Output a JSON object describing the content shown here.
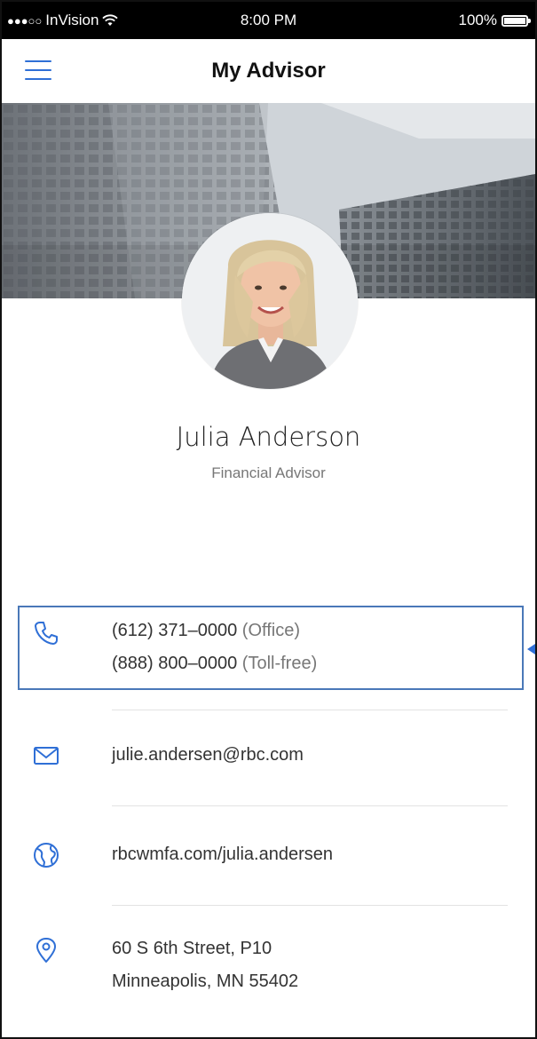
{
  "status_bar": {
    "signal_dots": "●●●○○",
    "carrier": "InVision",
    "time": "8:00 PM",
    "battery": "100%"
  },
  "nav": {
    "title": "My Advisor",
    "menu_icon": "hamburger-menu-icon"
  },
  "profile": {
    "name": "Julia Anderson",
    "role": "Financial Advisor"
  },
  "contacts": {
    "phone": [
      {
        "number": "(612) 371–0000",
        "label": "(Office)"
      },
      {
        "number": "(888) 800–0000",
        "label": "(Toll-free)"
      }
    ],
    "email": "julie.andersen@rbc.com",
    "website": "rbcwmfa.com/julia.andersen",
    "address_line1": "60 S 6th Street, P10",
    "address_line2": "Minneapolis, MN 55402"
  },
  "colors": {
    "accent": "#2f6fd6",
    "highlight_border": "#4a78b8",
    "text": "#333333",
    "muted_text": "#777777"
  }
}
